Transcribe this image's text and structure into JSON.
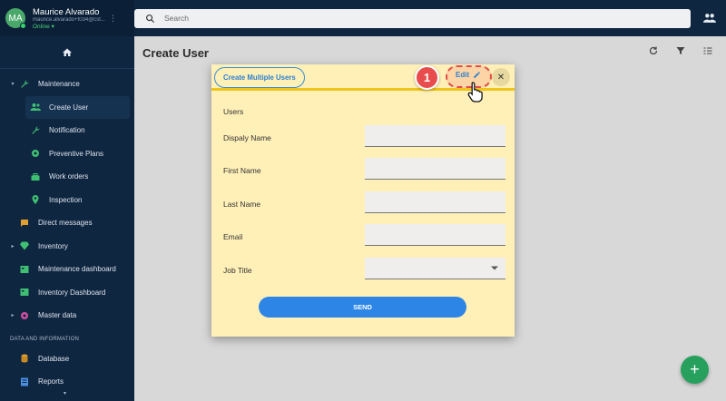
{
  "user": {
    "initials": "MA",
    "name": "Maurice Alvarado",
    "email": "maurice.alvarado+t034@cst...",
    "status": "Online"
  },
  "search": {
    "placeholder": "Search"
  },
  "sidebar": {
    "maintenance": "Maintenance",
    "create_user": "Create User",
    "notification": "Notification",
    "preventive_plans": "Preventive Plans",
    "work_orders": "Work orders",
    "inspection": "Inspection",
    "direct_messages": "Direct messages",
    "inventory": "Inventory",
    "maintenance_dashboard": "Maintenance dashboard",
    "inventory_dashboard": "Inventory Dashboard",
    "master_data": "Master data",
    "section_data": "DATA AND INFORMATION",
    "database": "Database",
    "reports": "Reports"
  },
  "page": {
    "title": "Create User"
  },
  "dialog": {
    "multi_label": "Create Multiple Users",
    "edit_label": "Edit",
    "step_number": "1",
    "section": "Users",
    "fields": {
      "display_name": "Dispaly Name",
      "first_name": "First Name",
      "last_name": "Last Name",
      "email": "Email",
      "job_title": "Job Title"
    },
    "send_label": "SEND"
  },
  "colors": {
    "sidebar": "#0f2641",
    "accent": "#2d86e6",
    "dialog_bg": "#fff0b8",
    "dialog_bar": "#f0c419",
    "badge": "#e84c4c",
    "fab": "#27a05e"
  }
}
